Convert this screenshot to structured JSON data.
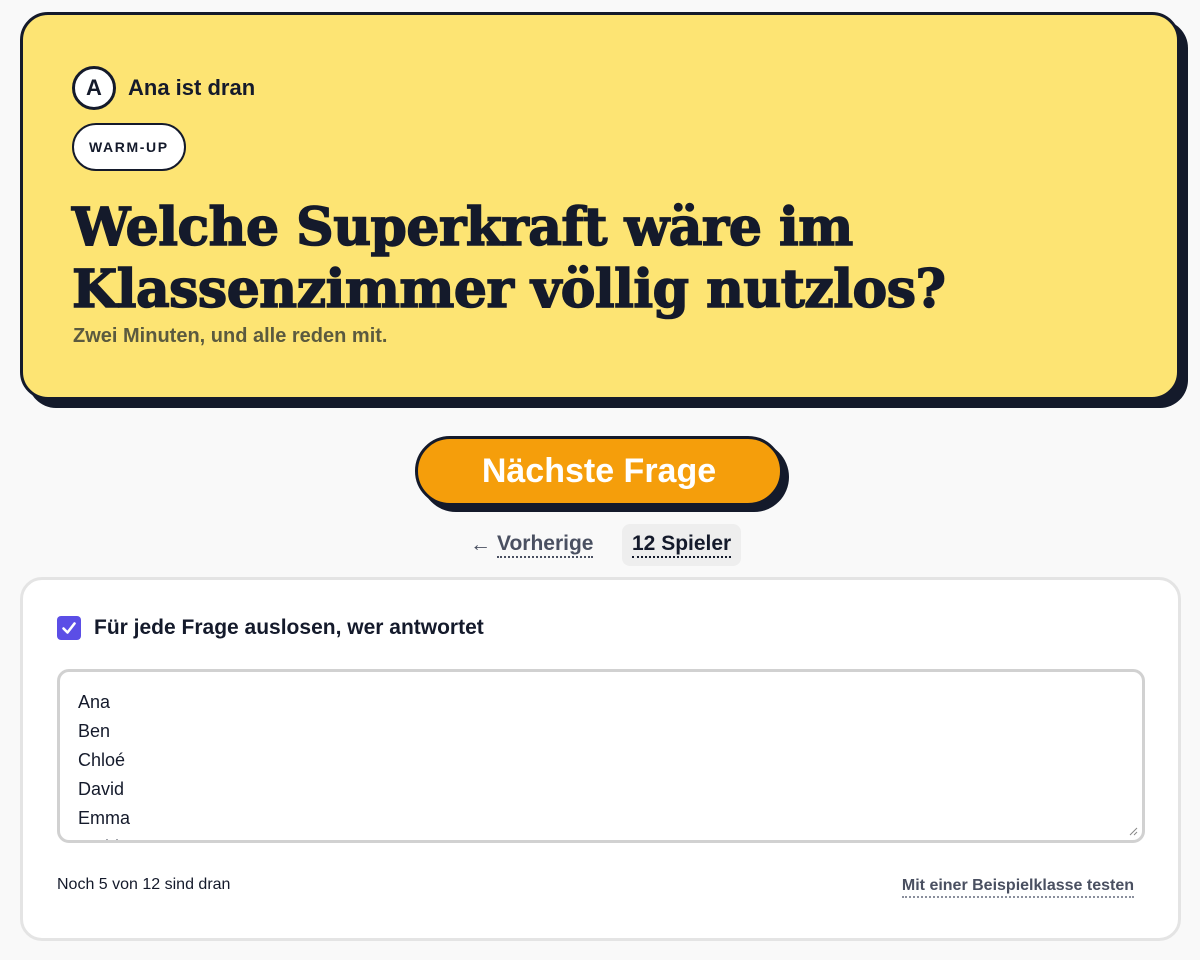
{
  "card": {
    "avatar_letter": "A",
    "turn_label": "Ana ist dran",
    "badge": "WARM-UP",
    "question": "Welche Superkraft wäre im Klassenzimmer völlig nutzlos?",
    "subtitle": "Zwei Minuten, und alle reden mit."
  },
  "controls": {
    "next_label": "Nächste Frage",
    "prev_arrow": "←",
    "prev_label": "Vorherige",
    "players_label": "12 Spieler"
  },
  "panel": {
    "checkbox_checked": true,
    "checkbox_label": "Für jede Frage auslosen, wer antwortet",
    "names_value": "Ana\nBen\nChloé\nDavid\nEmma\nFarid",
    "remaining_text": "Noch 5 von 12 sind dran",
    "sample_link": "Mit einer Beispielklasse testen"
  },
  "colors": {
    "card_bg": "#fde473",
    "button_bg": "#f59e0b",
    "checkbox_bg": "#5b4ee6",
    "ink": "#141a2b"
  },
  "icons": {
    "checkbox": "check-icon",
    "prev": "arrow-left-icon",
    "resize": "resize-grip-icon"
  }
}
